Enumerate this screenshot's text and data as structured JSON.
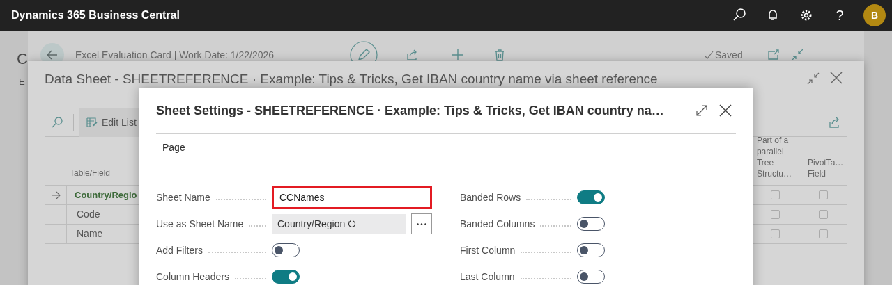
{
  "app_bar": {
    "title": "Dynamics 365 Business Central",
    "help": "?",
    "avatar": "B"
  },
  "background_page": {
    "side_texts": [
      "C",
      "E"
    ],
    "header": "Excel Evaluation Card | Work Date: 1/22/2026",
    "status": "Saved"
  },
  "data_sheet": {
    "title": "Data Sheet - SHEETREFERENCE · Example: Tips & Tricks, Get IBAN country name via sheet reference",
    "toolbar": [
      "Edit List"
    ],
    "columns": [
      "Table/Field",
      "Part of a parallel Tree Structu…",
      "PivotTa… Field"
    ],
    "rows": [
      {
        "field": "Country/Regio",
        "kind": "table",
        "selected": true,
        "part_of_tree": false,
        "pivot_field": false
      },
      {
        "field": "Code",
        "kind": "field",
        "selected": false,
        "part_of_tree": false,
        "pivot_field": false
      },
      {
        "field": "Name",
        "kind": "field",
        "selected": false,
        "part_of_tree": false,
        "pivot_field": false
      }
    ]
  },
  "sheet_settings": {
    "title": "Sheet Settings - SHEETREFERENCE · Example: Tips & Tricks, Get IBAN country na…",
    "tab": "Page",
    "left_fields": [
      {
        "kind": "text",
        "label": "Sheet Name",
        "value": "CCNames",
        "highlighted": true
      },
      {
        "kind": "lookup",
        "label": "Use as Sheet Name",
        "value": "Country/Region"
      },
      {
        "kind": "toggle",
        "label": "Add Filters",
        "on": false
      },
      {
        "kind": "toggle",
        "label": "Column Headers",
        "on": true
      }
    ],
    "right_fields": [
      {
        "kind": "toggle",
        "label": "Banded Rows",
        "on": true
      },
      {
        "kind": "toggle",
        "label": "Banded Columns",
        "on": false
      },
      {
        "kind": "toggle",
        "label": "First Column",
        "on": false
      },
      {
        "kind": "toggle",
        "label": "Last Column",
        "on": false
      }
    ]
  }
}
